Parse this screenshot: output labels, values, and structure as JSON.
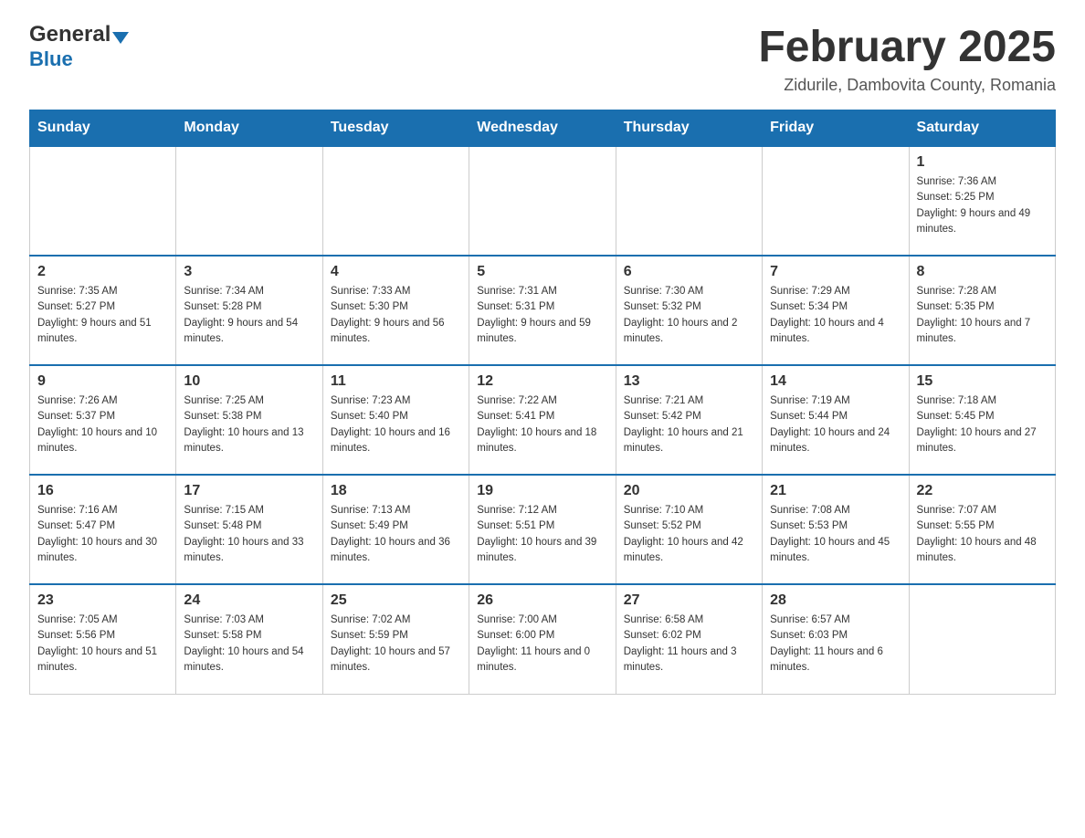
{
  "header": {
    "logo_general": "General",
    "logo_blue": "Blue",
    "month_title": "February 2025",
    "location": "Zidurile, Dambovita County, Romania"
  },
  "days_of_week": [
    "Sunday",
    "Monday",
    "Tuesday",
    "Wednesday",
    "Thursday",
    "Friday",
    "Saturday"
  ],
  "weeks": [
    [
      {
        "day": "",
        "info": ""
      },
      {
        "day": "",
        "info": ""
      },
      {
        "day": "",
        "info": ""
      },
      {
        "day": "",
        "info": ""
      },
      {
        "day": "",
        "info": ""
      },
      {
        "day": "",
        "info": ""
      },
      {
        "day": "1",
        "info": "Sunrise: 7:36 AM\nSunset: 5:25 PM\nDaylight: 9 hours and 49 minutes."
      }
    ],
    [
      {
        "day": "2",
        "info": "Sunrise: 7:35 AM\nSunset: 5:27 PM\nDaylight: 9 hours and 51 minutes."
      },
      {
        "day": "3",
        "info": "Sunrise: 7:34 AM\nSunset: 5:28 PM\nDaylight: 9 hours and 54 minutes."
      },
      {
        "day": "4",
        "info": "Sunrise: 7:33 AM\nSunset: 5:30 PM\nDaylight: 9 hours and 56 minutes."
      },
      {
        "day": "5",
        "info": "Sunrise: 7:31 AM\nSunset: 5:31 PM\nDaylight: 9 hours and 59 minutes."
      },
      {
        "day": "6",
        "info": "Sunrise: 7:30 AM\nSunset: 5:32 PM\nDaylight: 10 hours and 2 minutes."
      },
      {
        "day": "7",
        "info": "Sunrise: 7:29 AM\nSunset: 5:34 PM\nDaylight: 10 hours and 4 minutes."
      },
      {
        "day": "8",
        "info": "Sunrise: 7:28 AM\nSunset: 5:35 PM\nDaylight: 10 hours and 7 minutes."
      }
    ],
    [
      {
        "day": "9",
        "info": "Sunrise: 7:26 AM\nSunset: 5:37 PM\nDaylight: 10 hours and 10 minutes."
      },
      {
        "day": "10",
        "info": "Sunrise: 7:25 AM\nSunset: 5:38 PM\nDaylight: 10 hours and 13 minutes."
      },
      {
        "day": "11",
        "info": "Sunrise: 7:23 AM\nSunset: 5:40 PM\nDaylight: 10 hours and 16 minutes."
      },
      {
        "day": "12",
        "info": "Sunrise: 7:22 AM\nSunset: 5:41 PM\nDaylight: 10 hours and 18 minutes."
      },
      {
        "day": "13",
        "info": "Sunrise: 7:21 AM\nSunset: 5:42 PM\nDaylight: 10 hours and 21 minutes."
      },
      {
        "day": "14",
        "info": "Sunrise: 7:19 AM\nSunset: 5:44 PM\nDaylight: 10 hours and 24 minutes."
      },
      {
        "day": "15",
        "info": "Sunrise: 7:18 AM\nSunset: 5:45 PM\nDaylight: 10 hours and 27 minutes."
      }
    ],
    [
      {
        "day": "16",
        "info": "Sunrise: 7:16 AM\nSunset: 5:47 PM\nDaylight: 10 hours and 30 minutes."
      },
      {
        "day": "17",
        "info": "Sunrise: 7:15 AM\nSunset: 5:48 PM\nDaylight: 10 hours and 33 minutes."
      },
      {
        "day": "18",
        "info": "Sunrise: 7:13 AM\nSunset: 5:49 PM\nDaylight: 10 hours and 36 minutes."
      },
      {
        "day": "19",
        "info": "Sunrise: 7:12 AM\nSunset: 5:51 PM\nDaylight: 10 hours and 39 minutes."
      },
      {
        "day": "20",
        "info": "Sunrise: 7:10 AM\nSunset: 5:52 PM\nDaylight: 10 hours and 42 minutes."
      },
      {
        "day": "21",
        "info": "Sunrise: 7:08 AM\nSunset: 5:53 PM\nDaylight: 10 hours and 45 minutes."
      },
      {
        "day": "22",
        "info": "Sunrise: 7:07 AM\nSunset: 5:55 PM\nDaylight: 10 hours and 48 minutes."
      }
    ],
    [
      {
        "day": "23",
        "info": "Sunrise: 7:05 AM\nSunset: 5:56 PM\nDaylight: 10 hours and 51 minutes."
      },
      {
        "day": "24",
        "info": "Sunrise: 7:03 AM\nSunset: 5:58 PM\nDaylight: 10 hours and 54 minutes."
      },
      {
        "day": "25",
        "info": "Sunrise: 7:02 AM\nSunset: 5:59 PM\nDaylight: 10 hours and 57 minutes."
      },
      {
        "day": "26",
        "info": "Sunrise: 7:00 AM\nSunset: 6:00 PM\nDaylight: 11 hours and 0 minutes."
      },
      {
        "day": "27",
        "info": "Sunrise: 6:58 AM\nSunset: 6:02 PM\nDaylight: 11 hours and 3 minutes."
      },
      {
        "day": "28",
        "info": "Sunrise: 6:57 AM\nSunset: 6:03 PM\nDaylight: 11 hours and 6 minutes."
      },
      {
        "day": "",
        "info": ""
      }
    ]
  ],
  "colors": {
    "header_bg": "#1a6faf",
    "header_text": "#ffffff",
    "border": "#cccccc",
    "body_text": "#333333"
  }
}
